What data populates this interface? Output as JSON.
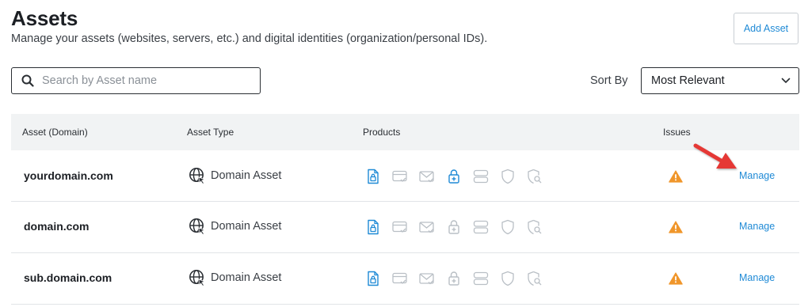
{
  "header": {
    "title": "Assets",
    "subtitle": "Manage your assets (websites, servers, etc.) and digital identities (organization/personal IDs).",
    "add_button": "Add Asset"
  },
  "search": {
    "placeholder": "Search by Asset name",
    "value": ""
  },
  "sort": {
    "label": "Sort By",
    "selected": "Most Relevant"
  },
  "table": {
    "columns": [
      "Asset (Domain)",
      "Asset Type",
      "Products",
      "Issues"
    ],
    "product_icons": [
      "ssl-certificate-icon",
      "payment-card-icon",
      "email-icon",
      "lock-plus-icon",
      "server-icon",
      "shield-icon",
      "shield-search-icon"
    ],
    "rows": [
      {
        "domain": "yourdomain.com",
        "type": "Domain Asset",
        "active_products": [
          0,
          3
        ],
        "issue": "warning-icon",
        "action": "Manage"
      },
      {
        "domain": "domain.com",
        "type": "Domain Asset",
        "active_products": [
          0
        ],
        "issue": "warning-icon",
        "action": "Manage"
      },
      {
        "domain": "sub.domain.com",
        "type": "Domain Asset",
        "active_products": [
          0
        ],
        "issue": "warning-icon",
        "action": "Manage"
      }
    ]
  },
  "colors": {
    "accent": "#1f8ad6",
    "warning": "#f0962b",
    "inactive_icon": "#b9bfc5",
    "annotation_arrow": "#e53935"
  }
}
